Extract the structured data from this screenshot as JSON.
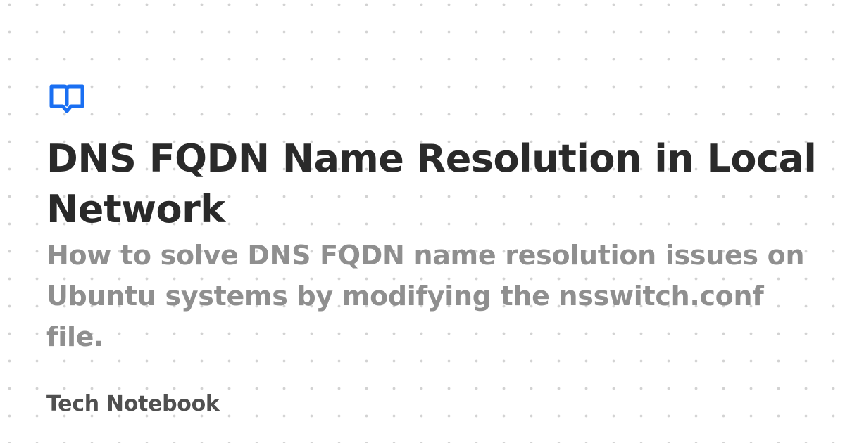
{
  "brand": {
    "icon": "book-icon",
    "color": "#1a6ff2"
  },
  "post": {
    "title": "DNS FQDN Name Resolution in Local Network",
    "description": "How to solve DNS FQDN name resolution issues on Ubuntu systems by modifying the nsswitch.conf file."
  },
  "site": {
    "name": "Tech Notebook"
  }
}
